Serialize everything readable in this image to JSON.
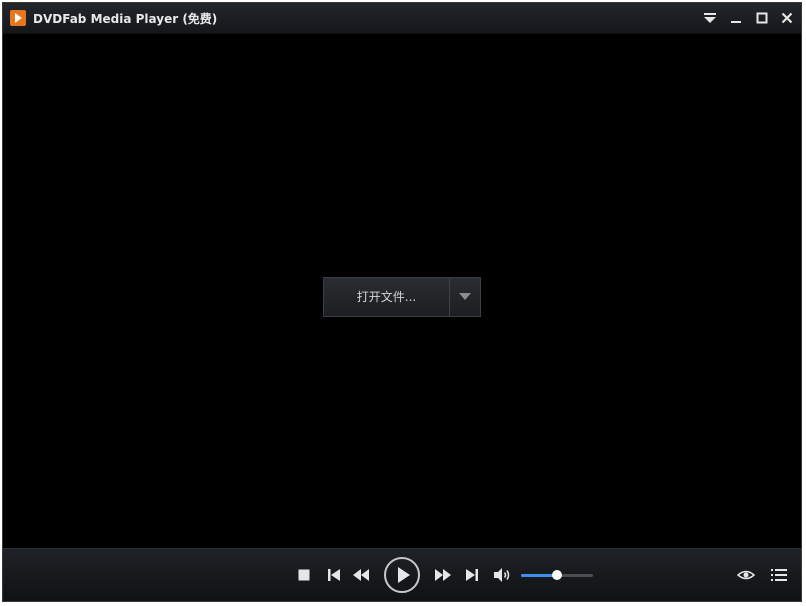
{
  "window": {
    "title": "DVDFab Media Player (免费)",
    "accent": "#e8741c"
  },
  "titlebar_buttons": [
    "menu-dropdown-icon",
    "minimize-icon",
    "maximize-icon",
    "close-icon"
  ],
  "center": {
    "open_file_label": "打开文件..."
  },
  "controls": {
    "icons": [
      "stop-icon",
      "previous-icon",
      "rewind-icon",
      "play-icon",
      "fast-forward-icon",
      "next-icon",
      "volume-icon",
      "eye-icon",
      "playlist-icon"
    ],
    "volume_level": 0.5,
    "volume_color": "#3f8ef0"
  }
}
